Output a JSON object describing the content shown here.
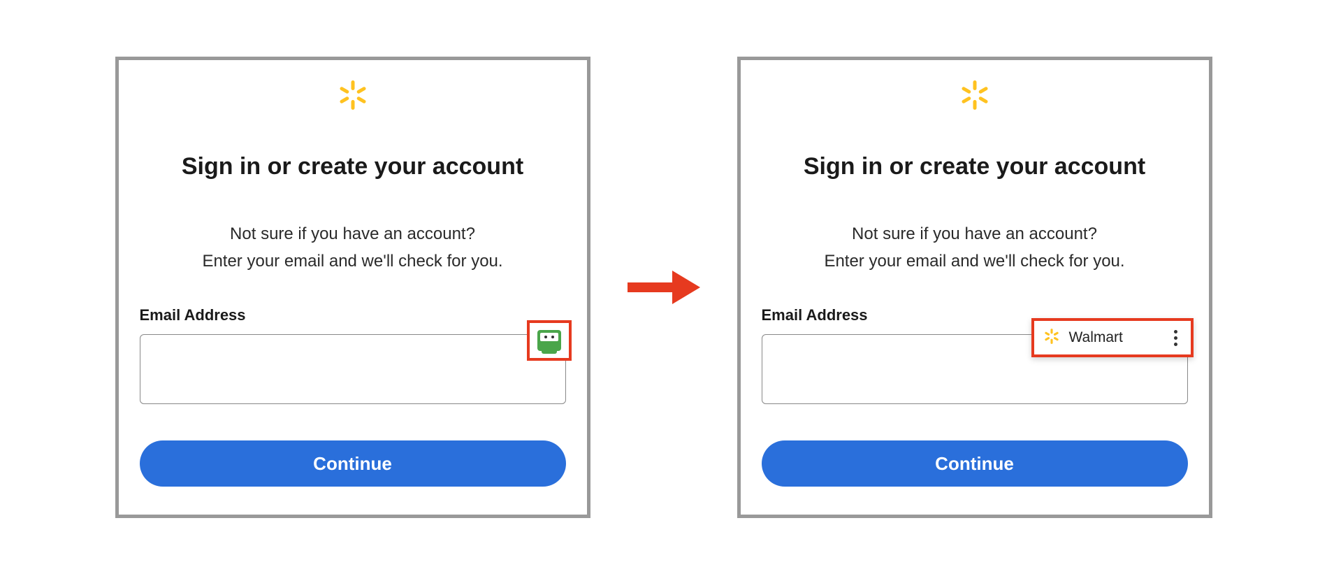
{
  "left": {
    "title": "Sign in or create your account",
    "subtitle_line1": "Not sure if you have an account?",
    "subtitle_line2": "Enter your email and we'll check for you.",
    "email_label": "Email Address",
    "email_value": "",
    "continue_label": "Continue"
  },
  "right": {
    "title": "Sign in or create your account",
    "subtitle_line1": "Not sure if you have an account?",
    "subtitle_line2": "Enter your email and we'll check for you.",
    "email_label": "Email Address",
    "email_value": "",
    "continue_label": "Continue",
    "suggestion_name": "Walmart"
  }
}
